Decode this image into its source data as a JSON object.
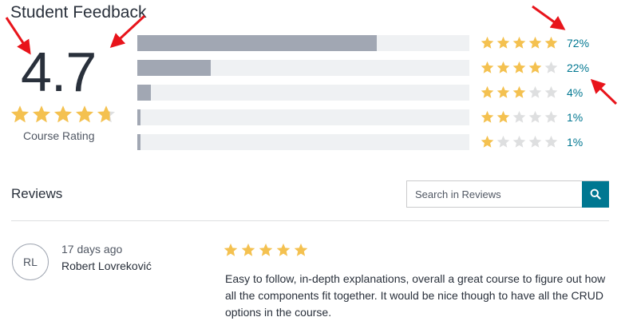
{
  "header": {
    "title": "Student Feedback"
  },
  "summary": {
    "rating": "4.7",
    "rating_value": 4.7,
    "label": "Course Rating"
  },
  "breakdown": [
    {
      "stars": 5,
      "percent": "72%",
      "fill": 0.72
    },
    {
      "stars": 4,
      "percent": "22%",
      "fill": 0.22
    },
    {
      "stars": 3,
      "percent": "4%",
      "fill": 0.04
    },
    {
      "stars": 2,
      "percent": "1%",
      "fill": 0.01
    },
    {
      "stars": 1,
      "percent": "1%",
      "fill": 0.01
    }
  ],
  "reviews": {
    "heading": "Reviews",
    "search": {
      "placeholder": "Search in Reviews",
      "value": "",
      "icon": "search-icon"
    },
    "items": [
      {
        "initials": "RL",
        "time_ago": "17 days ago",
        "name": "Robert Lovreković",
        "rating": 5,
        "text": "Easy to follow, in-depth explanations, overall a great course to figure out how all the components fit together. It would be nice though to have all the CRUD options in the course."
      }
    ]
  },
  "colors": {
    "star": "#f4c150",
    "star_empty": "#dedfe0",
    "bar_fill": "#a1a7b3",
    "bar_track": "#eff1f3",
    "accent": "#007791",
    "annotation_arrow": "#e8141b"
  }
}
